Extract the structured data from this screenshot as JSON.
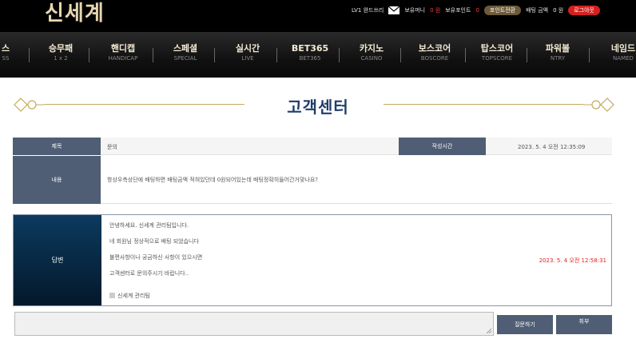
{
  "header": {
    "logo": "신세계",
    "level": "LV1 완드쓰리",
    "money_label": "보유머니",
    "money_value": "0 원",
    "point_label": "보유포인트",
    "point_value": "0",
    "point_button": "포인트전환",
    "bet_label": "배팅 금액",
    "bet_value": "0 원",
    "logout_button": "로그아웃"
  },
  "nav": [
    {
      "kr": "스",
      "en": "SS"
    },
    {
      "kr": "승무패",
      "en": "1 x 2"
    },
    {
      "kr": "핸디캡",
      "en": "HANDICAP"
    },
    {
      "kr": "스페셜",
      "en": "SPECIAL"
    },
    {
      "kr": "실시간",
      "en": "LIVE"
    },
    {
      "kr": "BET365",
      "en": "BET365"
    },
    {
      "kr": "카지노",
      "en": "CASINO"
    },
    {
      "kr": "보스코어",
      "en": "BOSCORE"
    },
    {
      "kr": "탑스코어",
      "en": "TOPSCORE"
    },
    {
      "kr": "파워볼",
      "en": "NTRY"
    },
    {
      "kr": "네임드",
      "en": "NAMED"
    }
  ],
  "page_title": "고객센터",
  "ticket": {
    "subject_label": "제목",
    "subject_value": "문의",
    "time_label": "작성시간",
    "time_value": "2023. 5. 4 오전 12:35:09",
    "content_label": "내용",
    "content_value": "항상우측상단에 배팅하면 배팅금액 적혀있던데 0원되어있는데 배팅정확히들어간거맞나요?"
  },
  "answer": {
    "label": "답변",
    "lines": [
      "안녕하세요. 신세계 관리팀입니다.",
      "네 회원님 정상적으로 배팅 되었습니다",
      "불편사항이나 궁금하신 사항이 있으시면",
      "고객센터로 문의주시기 바랍니다.."
    ],
    "signature": "신세계 관리팀",
    "date": "2023. 5. 4 오전 12:58:31"
  },
  "reply": {
    "placeholder": "",
    "submit_button": "질문하기",
    "cancel_button": "취부"
  },
  "colors": {
    "accent_gold": "#c7aa5a",
    "title_blue": "#1f3d6a",
    "label_slate": "#4f5e74",
    "logout_red": "#d42020"
  }
}
